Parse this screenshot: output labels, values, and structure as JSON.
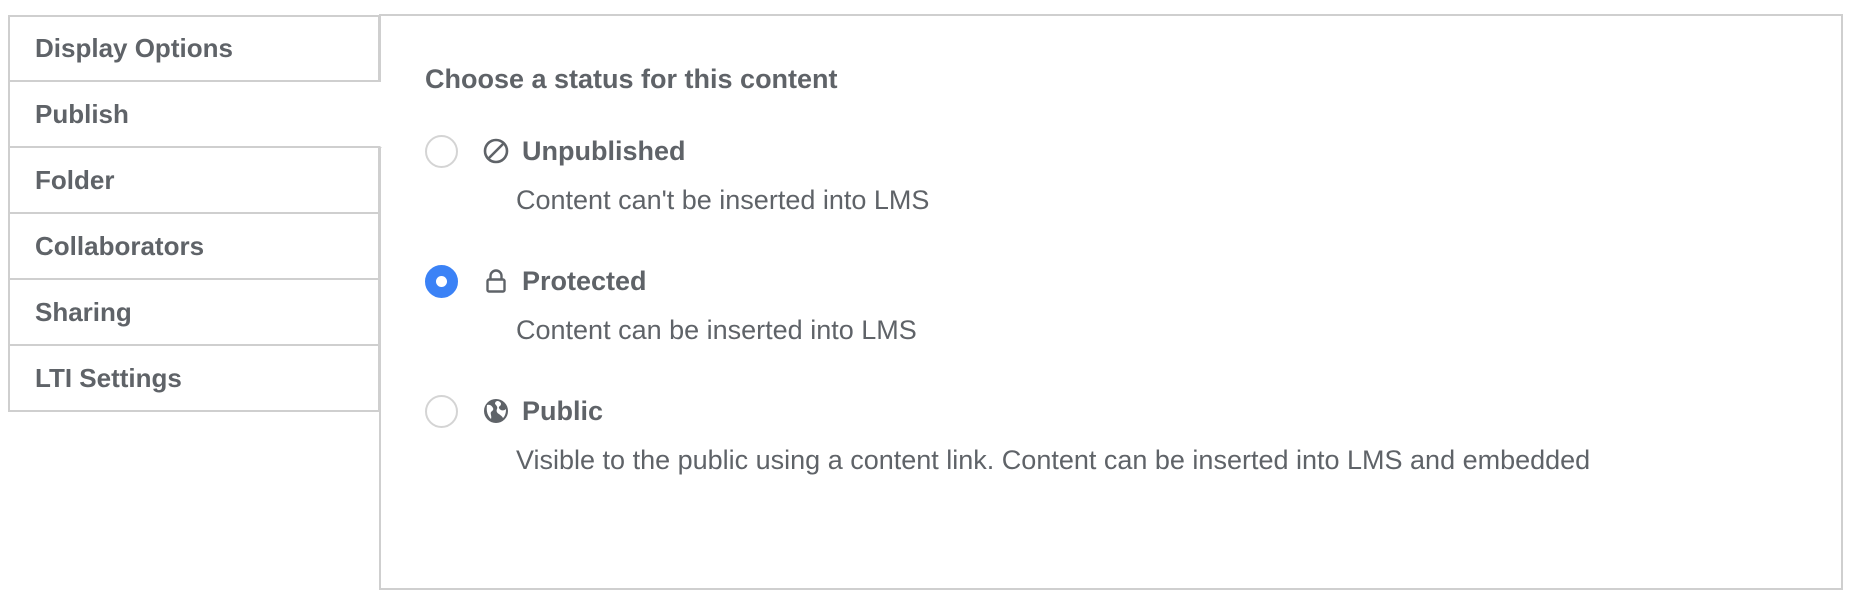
{
  "sidebar": {
    "tabs": [
      {
        "label": "Display Options"
      },
      {
        "label": "Publish"
      },
      {
        "label": "Folder"
      },
      {
        "label": "Collaborators"
      },
      {
        "label": "Sharing"
      },
      {
        "label": "LTI Settings"
      }
    ],
    "active": "Publish"
  },
  "panel": {
    "heading": "Choose a status for this content",
    "options": [
      {
        "label": "Unpublished",
        "description": "Content can't be inserted into LMS",
        "icon": "ban-icon",
        "selected": false
      },
      {
        "label": "Protected",
        "description": "Content can be inserted into LMS",
        "icon": "lock-icon",
        "selected": true
      },
      {
        "label": "Public",
        "description": "Visible to the public using a content link. Content can be inserted into LMS and embedded",
        "icon": "globe-icon",
        "selected": false
      }
    ]
  },
  "colors": {
    "accent": "#3b82f6",
    "text": "#5f6368",
    "border": "#cfcfcf"
  }
}
